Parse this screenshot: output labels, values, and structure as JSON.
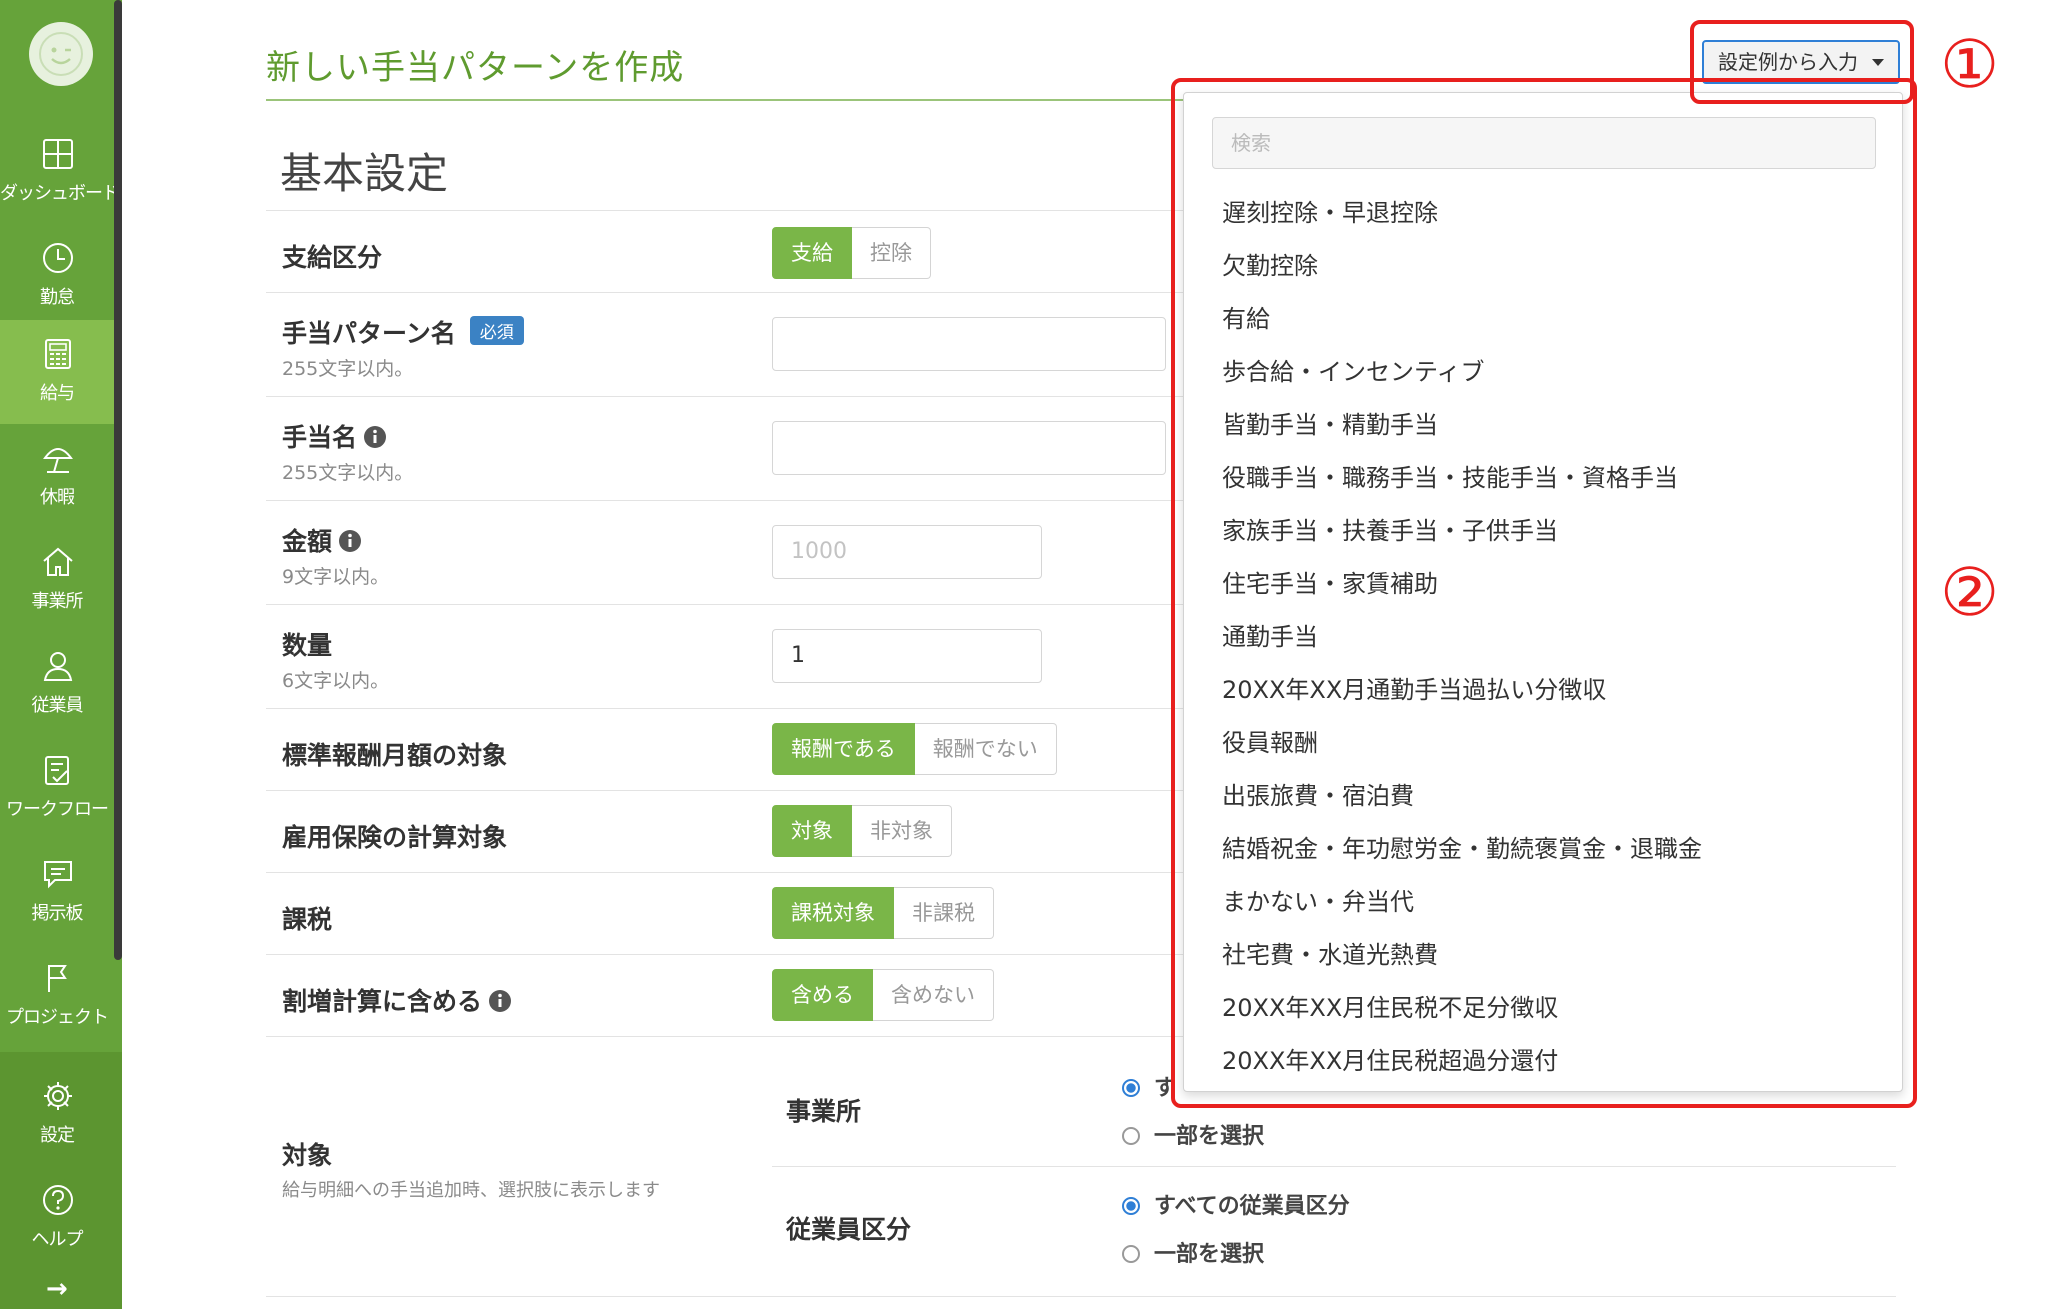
{
  "sidebar": {
    "items": [
      {
        "label": "ダッシュボード",
        "icon": "dashboard-icon"
      },
      {
        "label": "勤怠",
        "icon": "clock-icon"
      },
      {
        "label": "給与",
        "icon": "calculator-icon",
        "active": true
      },
      {
        "label": "休暇",
        "icon": "beach-umbrella-icon"
      },
      {
        "label": "事業所",
        "icon": "home-icon"
      },
      {
        "label": "従業員",
        "icon": "person-icon"
      },
      {
        "label": "ワークフロー",
        "icon": "checklist-icon"
      },
      {
        "label": "掲示板",
        "icon": "message-board-icon"
      },
      {
        "label": "プロジェクト",
        "icon": "flag-icon"
      }
    ],
    "bottom_items": [
      {
        "label": "設定",
        "icon": "gear-icon"
      },
      {
        "label": "ヘルプ",
        "icon": "help-icon"
      }
    ],
    "arrow": "→"
  },
  "page": {
    "title": "新しい手当パターンを作成",
    "section_title": "基本設定"
  },
  "form": {
    "payment_type": {
      "label": "支給区分",
      "on": "支給",
      "off": "控除"
    },
    "pattern_name": {
      "label": "手当パターン名",
      "badge": "必須",
      "help": "255文字以内。",
      "value": ""
    },
    "allowance_name": {
      "label": "手当名",
      "help": "255文字以内。",
      "value": ""
    },
    "amount": {
      "label": "金額",
      "help": "9文字以内。",
      "placeholder": "1000"
    },
    "quantity": {
      "label": "数量",
      "help": "6文字以内。",
      "value": "1"
    },
    "standard_remuneration": {
      "label": "標準報酬月額の対象",
      "on": "報酬である",
      "off": "報酬でない"
    },
    "employment_insurance": {
      "label": "雇用保険の計算対象",
      "on": "対象",
      "off": "非対象"
    },
    "taxation": {
      "label": "課税",
      "on": "課税対象",
      "off": "非課税"
    },
    "overtime": {
      "label": "割増計算に含める",
      "on": "含める",
      "off": "含めない"
    },
    "target": {
      "label": "対象",
      "help": "給与明細への手当追加時、選択肢に表示します",
      "office": {
        "label": "事業所",
        "option_all": "す",
        "option_some": "一部を選択"
      },
      "employee_type": {
        "label": "従業員区分",
        "option_all": "すべての従業員区分",
        "option_some": "一部を選択"
      }
    }
  },
  "dropdown": {
    "button_label": "設定例から入力",
    "search_placeholder": "検索",
    "items": [
      "遅刻控除・早退控除",
      "欠勤控除",
      "有給",
      "歩合給・インセンティブ",
      "皆勤手当・精勤手当",
      "役職手当・職務手当・技能手当・資格手当",
      "家族手当・扶養手当・子供手当",
      "住宅手当・家賃補助",
      "通勤手当",
      "20XX年XX月通勤手当過払い分徴収",
      "役員報酬",
      "出張旅費・宿泊費",
      "結婚祝金・年功慰労金・勤続褒賞金・退職金",
      "まかない・弁当代",
      "社宅費・水道光熱費",
      "20XX年XX月住民税不足分徴収",
      "20XX年XX月住民税超過分還付"
    ]
  },
  "annotations": {
    "callout_1": "①",
    "callout_2": "②",
    "color": "#e8201e"
  },
  "colors": {
    "sidebar": "#66a33a",
    "accent": "#7ab648",
    "title": "#5f9b2f",
    "link": "#2f7fd6"
  }
}
